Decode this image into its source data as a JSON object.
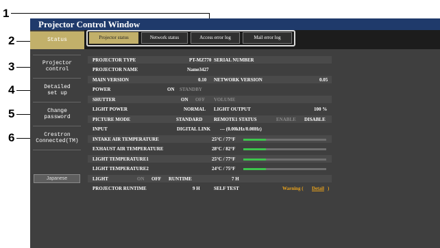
{
  "window": {
    "title": "Projector Control Window"
  },
  "callouts": [
    "1",
    "2",
    "3",
    "4",
    "5",
    "6"
  ],
  "sidebar": {
    "items": [
      {
        "label": "Status",
        "active": true
      },
      {
        "label": "Projector\ncontrol"
      },
      {
        "label": "Detailed\nset up"
      },
      {
        "label": "Change\npassword"
      },
      {
        "label": "Crestron\nConnected(TM)"
      }
    ],
    "language_button": "Japanese"
  },
  "tabs": [
    {
      "label": "Projector status",
      "active": true
    },
    {
      "label": "Network status"
    },
    {
      "label": "Access error log"
    },
    {
      "label": "Mail error log"
    }
  ],
  "status": {
    "projector_type_label": "PROJECTOR TYPE",
    "projector_type_value": "PT-MZ770",
    "serial_number_label": "SERIAL NUMBER",
    "projector_name_label": "PROJECTOR NAME",
    "projector_name_value": "Name3427",
    "main_version_label": "MAIN VERSION",
    "main_version_value": "0.10",
    "network_version_label": "NETWORK VERSION",
    "network_version_value": "0.05",
    "power_label": "POWER",
    "power_on": "ON",
    "power_standby": "STANDBY",
    "shutter_label": "SHUTTER",
    "shutter_on": "ON",
    "shutter_off": "OFF",
    "volume_label": "VOLUME",
    "light_power_label": "LIGHT POWER",
    "light_power_value": "NORMAL",
    "light_output_label": "LIGHT OUTPUT",
    "light_output_value": "100 %",
    "picture_mode_label": "PICTURE MODE",
    "picture_mode_value": "STANDARD",
    "remote1_label": "REMOTE1 STATUS",
    "remote1_enable": "ENABLE",
    "remote1_disable": "DISABLE",
    "input_label": "INPUT",
    "input_value": "DIGITAL LINK",
    "input_freq": "--- (0.00kHz/0.00Hz)",
    "temps": [
      {
        "label": "INTAKE AIR TEMPERATURE",
        "value": "25°C / 77°F",
        "level": 0.27
      },
      {
        "label": "EXHAUST AIR TEMPERATURE",
        "value": "28°C / 82°F",
        "level": 0.27
      },
      {
        "label": "LIGHT TEMPERATURE1",
        "value": "25°C / 77°F",
        "level": 0.27
      },
      {
        "label": "LIGHT TEMPERATURE2",
        "value": "24°C / 75°F",
        "level": 0.27
      }
    ],
    "light_label": "LIGHT",
    "light_on": "ON",
    "light_off": "OFF",
    "runtime_label": "RUNTIME",
    "runtime_value": "7 H",
    "projector_runtime_label": "PROJECTOR RUNTIME",
    "projector_runtime_value": "9 H",
    "self_test_label": "SELF TEST",
    "self_test_warning": "Warning (",
    "self_test_detail": "Detail",
    "self_test_close": ")"
  },
  "colors": {
    "title_bar": "#1f3a6b",
    "active_gold": "#c2b06a",
    "panel": "#3f3f3f",
    "temp_bar": "#3ec44d",
    "warning": "#e8a21c"
  }
}
